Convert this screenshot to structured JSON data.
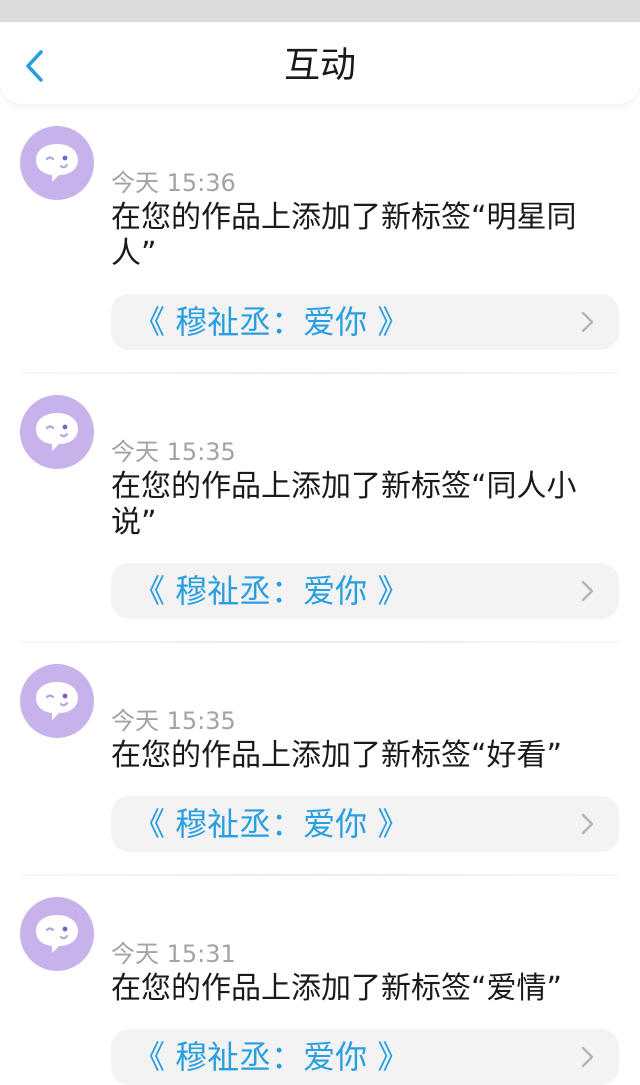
{
  "header": {
    "title": "互动"
  },
  "colors": {
    "accent": "#2a9fe0",
    "avatar_bg": "#c8b2ec",
    "card_bg": "#f3f3f3",
    "time_text": "#a3a3a3"
  },
  "messages": [
    {
      "time": "今天 15:36",
      "text": "在您的作品上添加了新标签“明星同人”",
      "work": "《 穆祉丞：爱你 》"
    },
    {
      "time": "今天 15:35",
      "text": "在您的作品上添加了新标签“同人小说”",
      "work": "《 穆祉丞：爱你 》"
    },
    {
      "time": "今天 15:35",
      "text": "在您的作品上添加了新标签“好看”",
      "work": "《 穆祉丞：爱你 》"
    },
    {
      "time": "今天 15:31",
      "text": "在您的作品上添加了新标签“爱情”",
      "work": "《 穆祉丞：爱你 》"
    }
  ]
}
